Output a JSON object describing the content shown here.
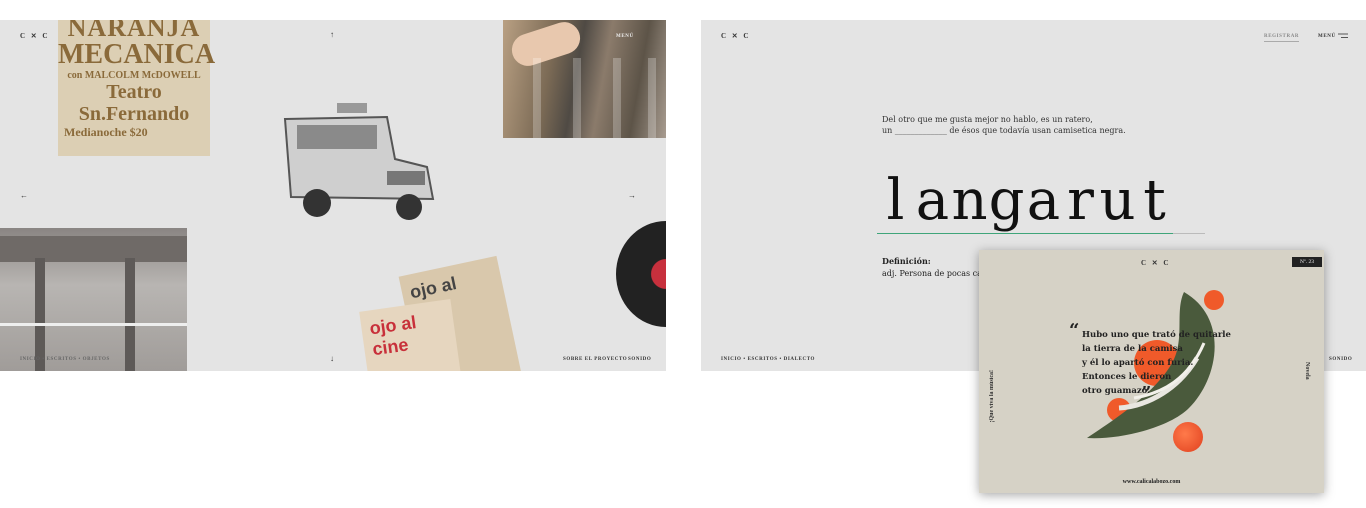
{
  "brand": {
    "logo": "C ✕ C"
  },
  "left_screen": {
    "nav": {
      "links": "INICIO • ESCRITOS • OBJETOS",
      "about": "SOBRE EL PROYECTO",
      "sound": "SONIDO",
      "menu": "MENÚ"
    },
    "poster": {
      "line1": "NARANJA",
      "line2": "MECANICA",
      "line3": "con MALCOLM McDOWELL",
      "line4": "Teatro Sn.Fernando",
      "line5": "Medianoche   $20"
    },
    "magazine": {
      "title": "ojo al cine"
    },
    "arrows": {
      "up": "↑",
      "down": "↓",
      "left": "←",
      "right": "→"
    }
  },
  "right_screen": {
    "nav": {
      "register": "REGISTRAR",
      "menu": "MENÚ",
      "links": "INICIO • ESCRITOS • DIALECTO",
      "sound": "SONIDO"
    },
    "sentence": {
      "line1": "Del otro que me gusta mejor no hablo, es un ratero,",
      "line2": "un _____________ de ésos que todavía usan camisetica negra."
    },
    "word_letters": [
      "l",
      "a",
      "n",
      "g",
      "a",
      "r",
      "u",
      "t",
      ""
    ],
    "definition_label": "Definición:",
    "definition_text": "adj. Persona de pocas cames"
  },
  "card": {
    "badge": "Nº. 23",
    "quote_lines": [
      "Hubo uno que trató de quitarle",
      "la tierra de la camisa",
      "y él lo apartó con furia.",
      "Entonces le dieron",
      "otro guamazo."
    ],
    "side_left": "¡Que viva la música!",
    "side_right": "Novela",
    "url": "www.calicalabozo.com"
  },
  "colors": {
    "panel": "#e4e4e4",
    "accent_green": "#3fa57a",
    "card_bg": "#d6d2c6",
    "orange": "#f05a2a"
  }
}
